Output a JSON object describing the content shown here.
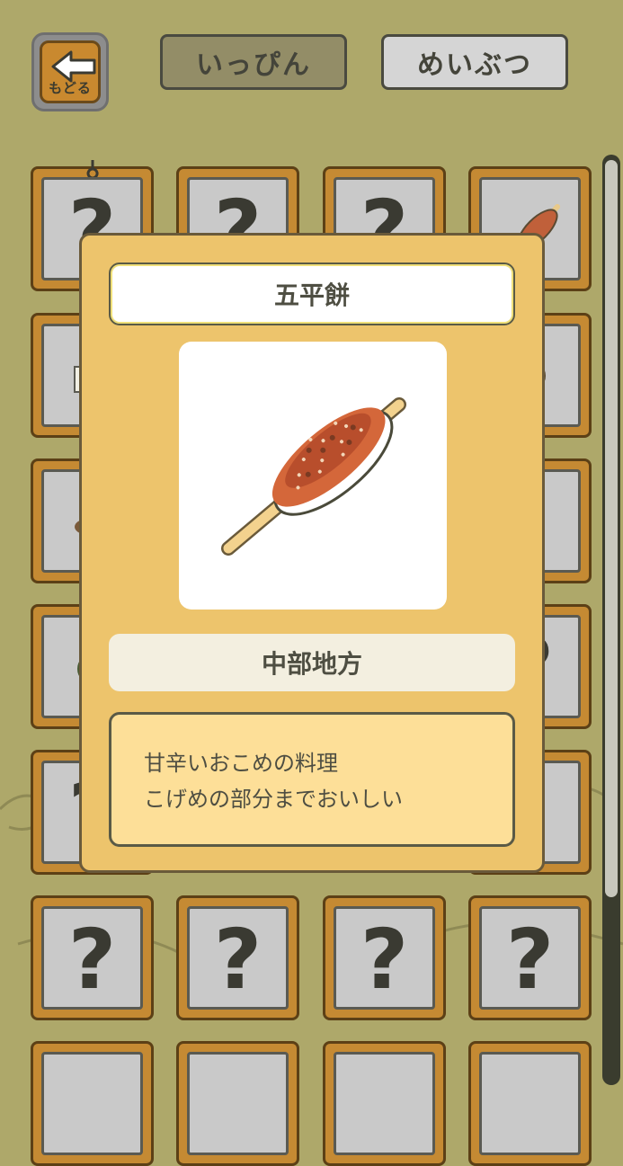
{
  "topbar": {
    "back_label": "もどる",
    "tabs": [
      {
        "label": "いっぴん",
        "selected": true
      },
      {
        "label": "めいぶつ",
        "selected": false
      }
    ]
  },
  "grid": {
    "unknown_symbol": "?"
  },
  "detail": {
    "name": "五平餅",
    "region": "中部地方",
    "description_lines": [
      "甘辛いおこめの料理",
      "こげめの部分までおいしい"
    ],
    "image_icon": "gohei-mochi-skewer-icon"
  },
  "colors": {
    "background": "#aea86a",
    "card_frame": "#c58a33",
    "modal": "#edc46c"
  }
}
